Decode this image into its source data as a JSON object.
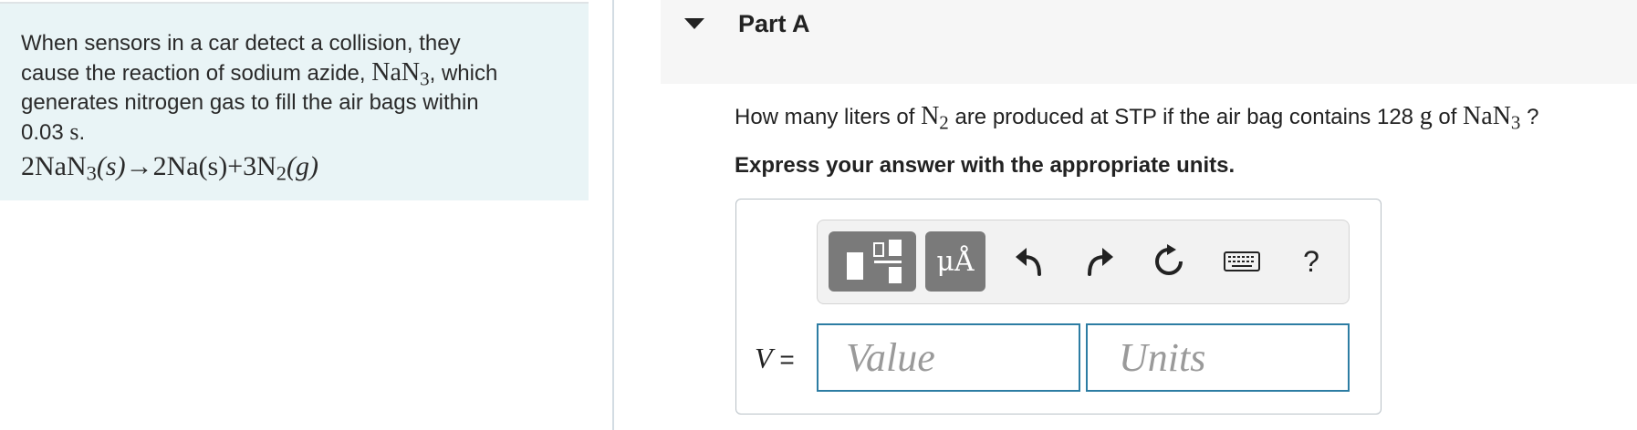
{
  "problem": {
    "intro_line1": "When sensors in a car detect a collision, they",
    "intro_line2_pre": "cause the reaction of sodium azide,",
    "compound_base": "NaN",
    "compound_sub": "3",
    "intro_line2_post": ", which",
    "intro_line3": "generates nitrogen gas to fill the air bags within",
    "time_value": "0.03",
    "time_unit": "s",
    "reaction": {
      "r_coef": "2NaN",
      "r_sub": "3",
      "r_state": "(s)",
      "arrow": "→",
      "p1": "2Na(s)",
      "plus": "+",
      "p2_coef": "3N",
      "p2_sub": "2",
      "p2_state": "(g)"
    }
  },
  "part": {
    "title": "Part A",
    "q_pre": "How many liters of",
    "q_species_base": "N",
    "q_species_sub": "2",
    "q_mid": "are produced at STP if the air bag contains 128",
    "q_mass_unit": "g",
    "q_of": "of",
    "q_compound_base": "NaN",
    "q_compound_sub": "3",
    "q_end": "?",
    "instruction": "Express your answer with the appropriate units."
  },
  "toolbar": {
    "units_label": "μÅ",
    "help_label": "?"
  },
  "answer": {
    "variable": "V",
    "equals": "=",
    "value_placeholder": "Value",
    "units_placeholder": "Units"
  },
  "colors": {
    "panel_bg": "#e9f4f6",
    "input_border": "#2d7da3",
    "toolbar_button": "#7a7a7a"
  },
  "icons": [
    "templates-icon",
    "undo-icon",
    "redo-icon",
    "reset-icon",
    "keyboard-icon",
    "help-icon",
    "collapse-caret-icon"
  ]
}
